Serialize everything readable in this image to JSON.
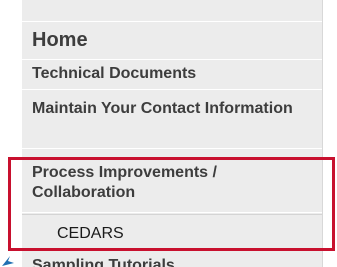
{
  "nav": {
    "items": [
      {
        "label": "Home"
      },
      {
        "label": "Technical Documents"
      },
      {
        "label": "Maintain Your Contact Information"
      },
      {
        "label": "Process Improvements / Collaboration"
      },
      {
        "label": "CEDARS"
      },
      {
        "label": "Sampling Tutorials"
      }
    ]
  },
  "highlight": {
    "color": "#c8102e"
  },
  "colors": {
    "nav_bg": "#ececec",
    "text": "#3d3d3d"
  }
}
